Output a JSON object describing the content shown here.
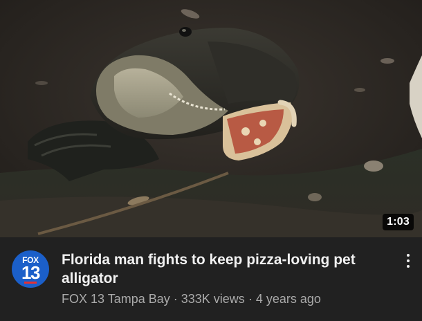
{
  "video": {
    "duration": "1:03",
    "title": "Florida man fights to keep pizza-loving pet alligator",
    "channel": "FOX 13 Tampa Bay",
    "views": "333K views",
    "age": "4 years ago",
    "separator": " · "
  },
  "channel_avatar": {
    "logo_text_top": "FOX",
    "logo_text_bottom": "13",
    "brand_color": "#1b5fc9",
    "accent_color": "#e63030"
  },
  "icons": {
    "more": "vertical-dots-icon"
  }
}
